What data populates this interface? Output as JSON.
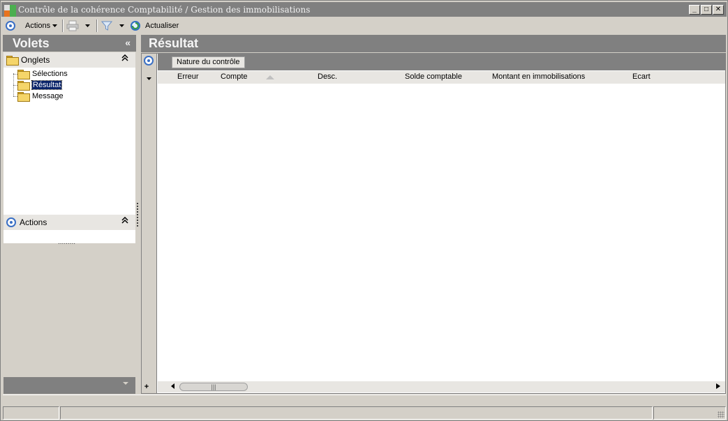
{
  "window": {
    "title": "Contrôle de la cohérence Comptabilité / Gestion des immobilisations",
    "min_glyph": "_",
    "max_glyph": "□",
    "close_glyph": "✕"
  },
  "toolbar": {
    "actions_label": "Actions",
    "refresh_label": "Actualiser"
  },
  "left_pane": {
    "title": "Volets",
    "collapse_glyph": "«",
    "onglets": {
      "label": "Onglets",
      "items": [
        {
          "label": "Sélections",
          "selected": false
        },
        {
          "label": "Résultat",
          "selected": true
        },
        {
          "label": "Message",
          "selected": false
        }
      ]
    },
    "actions_section": {
      "label": "Actions"
    }
  },
  "right_pane": {
    "title": "Résultat",
    "group_by_chip": "Nature du contrôle",
    "columns": [
      "Erreur",
      "Compte",
      "Desc.",
      "Solde comptable",
      "Montant en immobilisations",
      "Ecart"
    ],
    "rows": []
  },
  "colors": {
    "header_dark": "#808080",
    "selection": "#0a246a",
    "panel_bg": "#d4d0c8",
    "accent_blue": "#3a6fc4"
  }
}
